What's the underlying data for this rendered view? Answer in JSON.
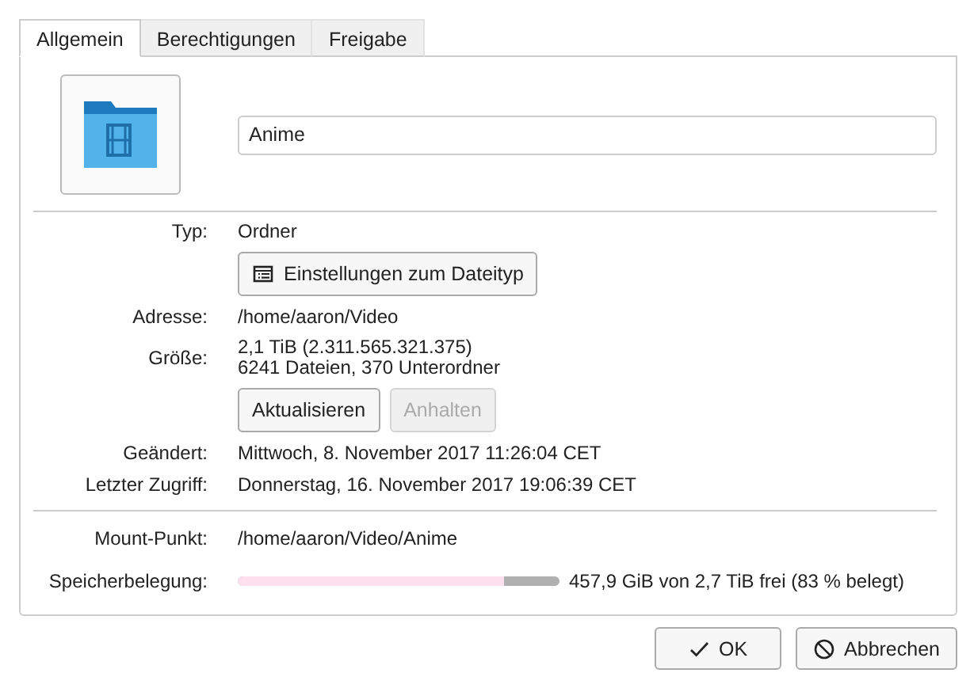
{
  "tabs": [
    {
      "label": "Allgemein",
      "selected": true
    },
    {
      "label": "Berechtigungen",
      "selected": false
    },
    {
      "label": "Freigabe",
      "selected": false
    }
  ],
  "name_field": {
    "value": "Anime"
  },
  "rows": [
    {
      "kind": "text",
      "label": "Typ:",
      "lines": [
        "Ordner"
      ]
    },
    {
      "kind": "buttons",
      "buttons": [
        {
          "label": "Einstellungen zum Dateityp",
          "kind": "listed",
          "disabled": false
        }
      ]
    },
    {
      "kind": "text",
      "label": "Adresse:",
      "lines": [
        "/home/aaron/Video"
      ]
    },
    {
      "kind": "text",
      "label": "Größe:",
      "lines": [
        "2,1 TiB (2.311.565.321.375)",
        "6241 Dateien, 370 Unterordner"
      ]
    },
    {
      "kind": "buttons",
      "buttons": [
        {
          "label": "Aktualisieren",
          "kind": "plain",
          "disabled": false
        },
        {
          "label": "Anhalten",
          "kind": "plain",
          "disabled": true
        }
      ]
    },
    {
      "kind": "text",
      "label": "Geändert:",
      "lines": [
        "Mittwoch, 8. November 2017 11:26:04 CET"
      ]
    },
    {
      "kind": "text",
      "label": "Letzter Zugriff:",
      "lines": [
        "Donnerstag, 16. November 2017 19:06:39 CET"
      ]
    },
    {
      "kind": "divider"
    },
    {
      "kind": "text",
      "label": "Mount-Punkt:",
      "lines": [
        "/home/aaron/Video/Anime"
      ]
    },
    {
      "kind": "meter",
      "label": "Speicherbelegung:",
      "level": 0.83,
      "reading": "457,9 GiB von 2,7 TiB frei (83 % belegt)"
    }
  ],
  "dialog_buttons": [
    {
      "label": "OK",
      "kind": "confirm"
    },
    {
      "label": "Abbrechen",
      "kind": "cancel"
    }
  ]
}
